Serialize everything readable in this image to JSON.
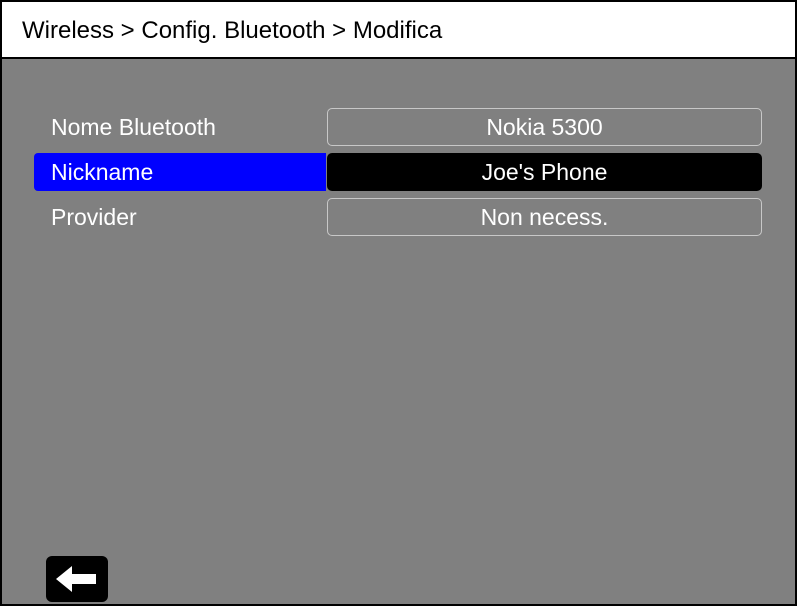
{
  "header": {
    "breadcrumb": "Wireless > Config. Bluetooth > Modifica"
  },
  "fields": [
    {
      "label": "Nome Bluetooth",
      "value": "Nokia 5300",
      "selected": false
    },
    {
      "label": "Nickname",
      "value": "Joe's Phone",
      "selected": true
    },
    {
      "label": "Provider",
      "value": "Non necess.",
      "selected": false
    }
  ],
  "footer": {
    "back_icon": "arrow-left-icon"
  },
  "colors": {
    "screen_background": "#808080",
    "selected_label_background": "#0000ff",
    "selected_value_background": "#000000",
    "header_background": "#ffffff"
  }
}
